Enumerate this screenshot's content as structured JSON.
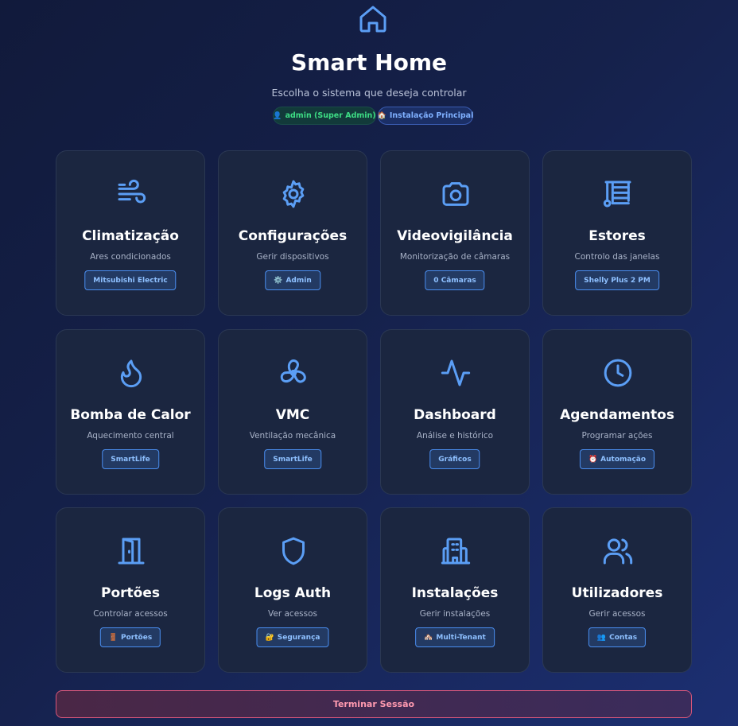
{
  "header": {
    "title": "Smart Home",
    "subtitle": "Escolha o sistema que deseja controlar",
    "user_pill": {
      "emoji": "👤",
      "label": "admin (Super Admin)"
    },
    "installation_pill": {
      "emoji": "🏠",
      "label": "Instalação Principal"
    }
  },
  "cards": [
    {
      "title": "Climatização",
      "desc": "Ares condicionados",
      "badge": "Mitsubishi Electric",
      "badge_emoji": "",
      "icon": "wind-icon"
    },
    {
      "title": "Configurações",
      "desc": "Gerir dispositivos",
      "badge": "Admin",
      "badge_emoji": "⚙️",
      "icon": "gear-icon"
    },
    {
      "title": "Videovigilância",
      "desc": "Monitorização de câmaras",
      "badge": "0 Câmaras",
      "badge_emoji": "",
      "icon": "camera-icon"
    },
    {
      "title": "Estores",
      "desc": "Controlo das janelas",
      "badge": "Shelly Plus 2 PM",
      "badge_emoji": "",
      "icon": "blinds-icon"
    },
    {
      "title": "Bomba de Calor",
      "desc": "Aquecimento central",
      "badge": "SmartLife",
      "badge_emoji": "",
      "icon": "flame-icon"
    },
    {
      "title": "VMC",
      "desc": "Ventilação mecânica",
      "badge": "SmartLife",
      "badge_emoji": "",
      "icon": "fan-icon"
    },
    {
      "title": "Dashboard",
      "desc": "Análise e histórico",
      "badge": "Gráficos",
      "badge_emoji": "",
      "icon": "activity-icon"
    },
    {
      "title": "Agendamentos",
      "desc": "Programar ações",
      "badge": "Automação",
      "badge_emoji": "⏰",
      "icon": "clock-icon"
    },
    {
      "title": "Portões",
      "desc": "Controlar acessos",
      "badge": "Portões",
      "badge_emoji": "🚪",
      "icon": "door-icon"
    },
    {
      "title": "Logs Auth",
      "desc": "Ver acessos",
      "badge": "Segurança",
      "badge_emoji": "🔐",
      "icon": "shield-icon"
    },
    {
      "title": "Instalações",
      "desc": "Gerir instalações",
      "badge": "Multi-Tenant",
      "badge_emoji": "🏘️",
      "icon": "building-icon"
    },
    {
      "title": "Utilizadores",
      "desc": "Gerir acessos",
      "badge": "Contas",
      "badge_emoji": "👥",
      "icon": "users-icon"
    }
  ],
  "logout_label": "Terminar Sessão",
  "colors": {
    "accent": "#5b9ef5",
    "card_bg": "#1b2640",
    "logout_border": "#d9567a"
  }
}
